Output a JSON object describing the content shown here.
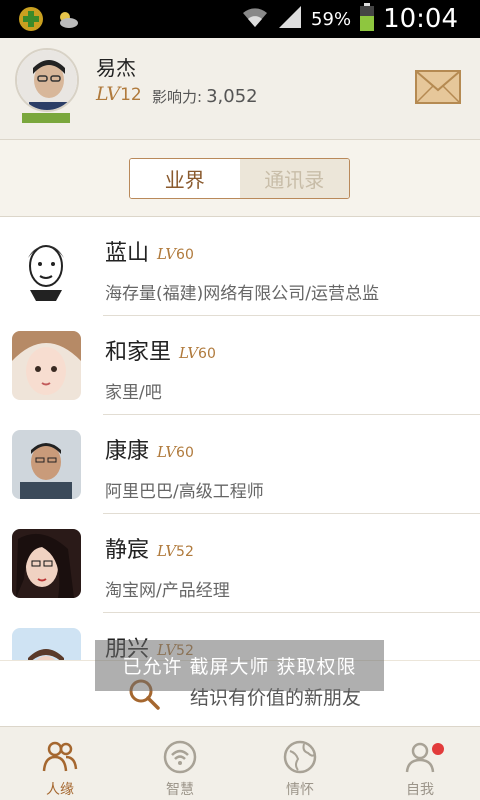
{
  "status_bar": {
    "battery_percent": "59%",
    "time": "10:04",
    "icons": [
      "app-plus-icon",
      "weather-icon",
      "wifi-icon",
      "signal-icon",
      "battery-icon"
    ]
  },
  "profile": {
    "name": "易杰",
    "level_prefix": "LV",
    "level": "12",
    "influence_label": "影响力:",
    "influence_value": "3,052"
  },
  "tabs": [
    {
      "label": "业界",
      "active": true
    },
    {
      "label": "通讯录",
      "active": false
    }
  ],
  "list": [
    {
      "name": "蓝山",
      "lv_prefix": "LV",
      "lv": "60",
      "subtitle": "海存量(福建)网络有限公司/运营总监"
    },
    {
      "name": "和家里",
      "lv_prefix": "LV",
      "lv": "60",
      "subtitle": "家里/吧"
    },
    {
      "name": "康康",
      "lv_prefix": "LV",
      "lv": "60",
      "subtitle": "阿里巴巴/高级工程师"
    },
    {
      "name": "静宸",
      "lv_prefix": "LV",
      "lv": "52",
      "subtitle": "淘宝网/产品经理"
    },
    {
      "name": "朋兴",
      "lv_prefix": "LV",
      "lv": "52",
      "subtitle": ""
    }
  ],
  "toast": "已允许 截屏大师 获取权限",
  "search": {
    "text": "结识有价值的新朋友"
  },
  "bottom_nav": [
    {
      "label": "人缘",
      "icon": "people-icon",
      "active": true
    },
    {
      "label": "智慧",
      "icon": "wisdom-icon",
      "active": false
    },
    {
      "label": "情怀",
      "icon": "globe-icon",
      "active": false
    },
    {
      "label": "自我",
      "icon": "self-icon",
      "active": false,
      "badge": true
    }
  ],
  "colors": {
    "accent": "#a5672f",
    "level": "#b07a3c",
    "badge": "#e23b3b",
    "online_bar": "#7aa73c"
  }
}
